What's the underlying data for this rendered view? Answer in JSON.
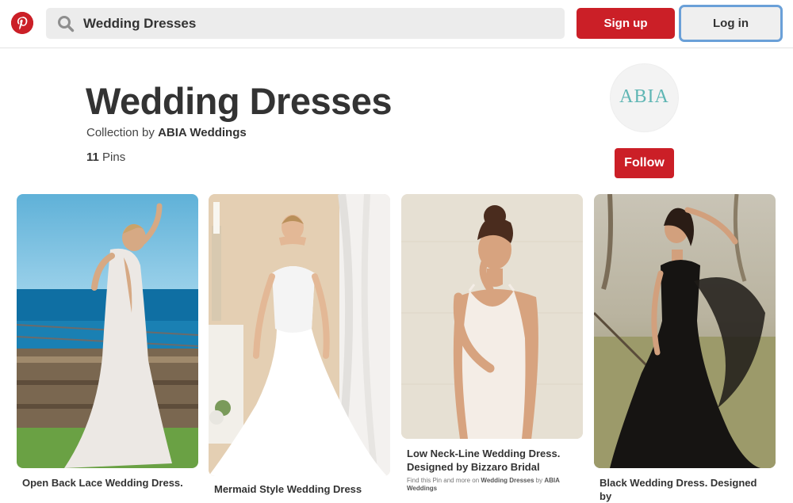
{
  "header": {
    "search_value": "Wedding Dresses",
    "signup_label": "Sign up",
    "login_label": "Log in"
  },
  "board": {
    "title": "Wedding Dresses",
    "collection_prefix": "Collection by",
    "owner": "ABIA Weddings",
    "pin_count": "11",
    "pins_label": "Pins",
    "avatar_text": "ABIA",
    "follow_label": "Follow"
  },
  "pins": [
    {
      "title": "Open Back Lace Wedding Dress."
    },
    {
      "title": "Mermaid Style Wedding Dress"
    },
    {
      "title": "Low Neck-Line Wedding Dress. Designed by Bizzaro Bridal",
      "meta_prefix": "Find this Pin and more on",
      "meta_board": "Wedding Dresses",
      "meta_by": "by",
      "meta_owner": "ABIA Weddings"
    },
    {
      "title": "Black Wedding Dress. Designed by"
    }
  ],
  "colors": {
    "brand_red": "#cb1f27",
    "search_bg": "#ececec",
    "focus_ring": "#6aa0d8"
  }
}
